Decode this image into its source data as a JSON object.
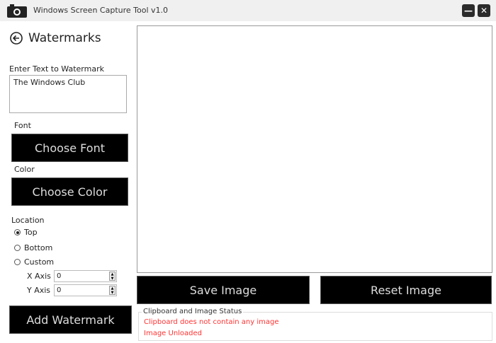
{
  "window": {
    "title": "Windows Screen Capture Tool v1.0",
    "minimize": "—",
    "close": "✕"
  },
  "sidebar": {
    "heading": "Watermarks",
    "text_label": "Enter Text to Watermark",
    "text_value": "The Windows Club",
    "font_label": "Font",
    "choose_font": "Choose Font",
    "color_label": "Color",
    "choose_color": "Choose Color",
    "location_label": "Location",
    "locations": [
      {
        "label": "Top",
        "selected": true
      },
      {
        "label": "Bottom",
        "selected": false
      },
      {
        "label": "Custom",
        "selected": false
      }
    ],
    "x_axis_label": "X Axis",
    "x_axis_value": "0",
    "y_axis_label": "Y Axis",
    "y_axis_value": "0",
    "add_watermark": "Add Watermark"
  },
  "main": {
    "save_image": "Save Image",
    "reset_image": "Reset Image",
    "status_title": "Clipboard and Image Status",
    "status_lines": [
      "Clipboard does not contain any image",
      "Image Unloaded"
    ],
    "status_color": "#ff3333"
  }
}
